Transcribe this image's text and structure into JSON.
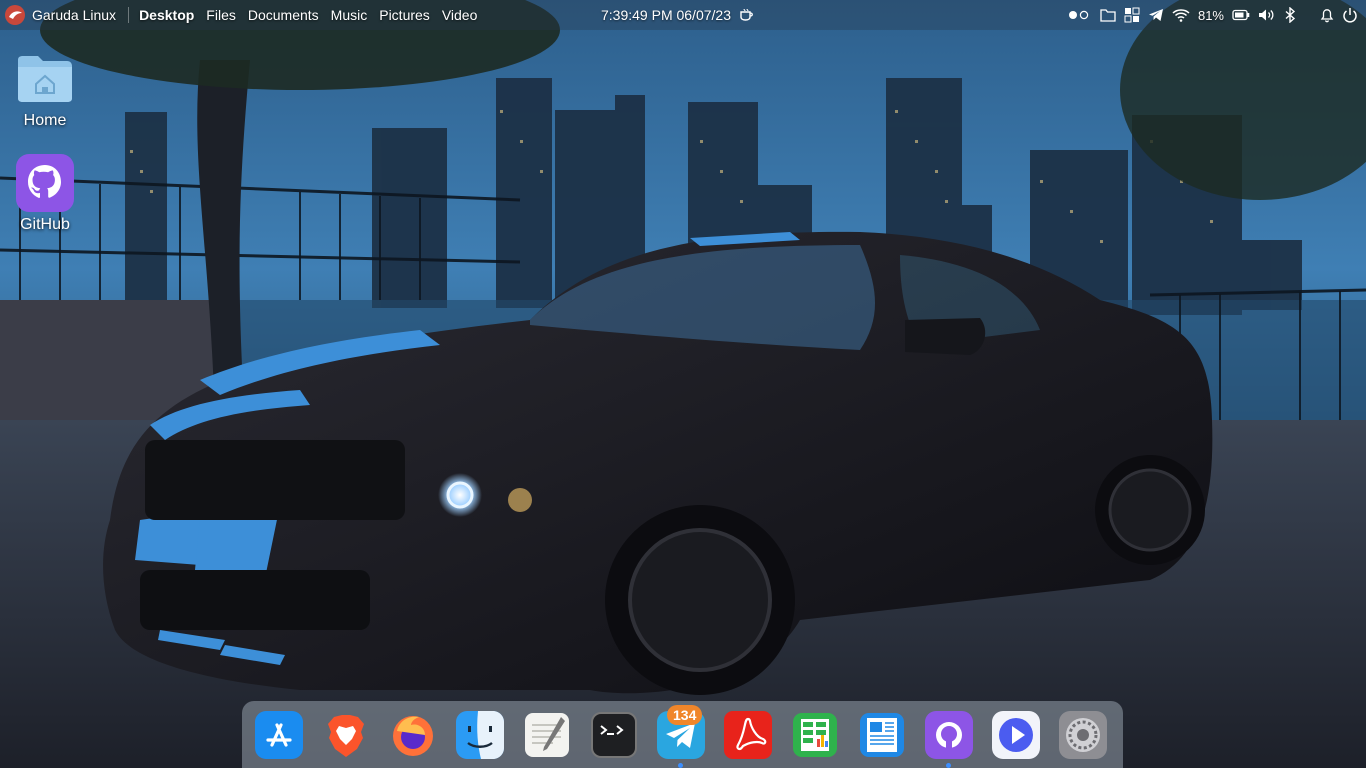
{
  "panel": {
    "distro_label": "Garuda Linux",
    "places": [
      {
        "label": "Desktop",
        "active": true
      },
      {
        "label": "Files",
        "active": false
      },
      {
        "label": "Documents",
        "active": false
      },
      {
        "label": "Music",
        "active": false
      },
      {
        "label": "Pictures",
        "active": false
      },
      {
        "label": "Video",
        "active": false
      }
    ],
    "clock": "7:39:49 PM 06/07/23",
    "battery_percent": "81%",
    "icons": [
      "workspace-dots-icon",
      "folder-icon",
      "window-grid-icon",
      "telegram-icon",
      "wifi-icon",
      "battery-icon",
      "volume-icon",
      "bluetooth-icon",
      "notification-bell-icon",
      "power-icon",
      "coffee-icon"
    ]
  },
  "desktop": {
    "icons": [
      {
        "label": "Home",
        "icon": "home-folder-icon"
      },
      {
        "label": "GitHub",
        "icon": "github-icon"
      }
    ]
  },
  "dock": {
    "items": [
      {
        "name": "App Store",
        "icon": "app-store-icon"
      },
      {
        "name": "Brave",
        "icon": "brave-icon"
      },
      {
        "name": "Firefox",
        "icon": "firefox-icon"
      },
      {
        "name": "Finder",
        "icon": "finder-icon"
      },
      {
        "name": "Text Editor",
        "icon": "text-editor-icon"
      },
      {
        "name": "Terminal",
        "icon": "terminal-icon"
      },
      {
        "name": "Telegram",
        "icon": "telegram-icon",
        "badge": "134"
      },
      {
        "name": "PDF Reader",
        "icon": "pdf-icon"
      },
      {
        "name": "Spreadsheet",
        "icon": "spreadsheet-icon"
      },
      {
        "name": "Document Viewer",
        "icon": "document-icon"
      },
      {
        "name": "GitHub",
        "icon": "github-icon"
      },
      {
        "name": "Video Player",
        "icon": "video-player-icon"
      },
      {
        "name": "System Settings",
        "icon": "settings-icon"
      }
    ]
  },
  "colors": {
    "accent": "#3d8fff",
    "badge": "#f0862a"
  }
}
